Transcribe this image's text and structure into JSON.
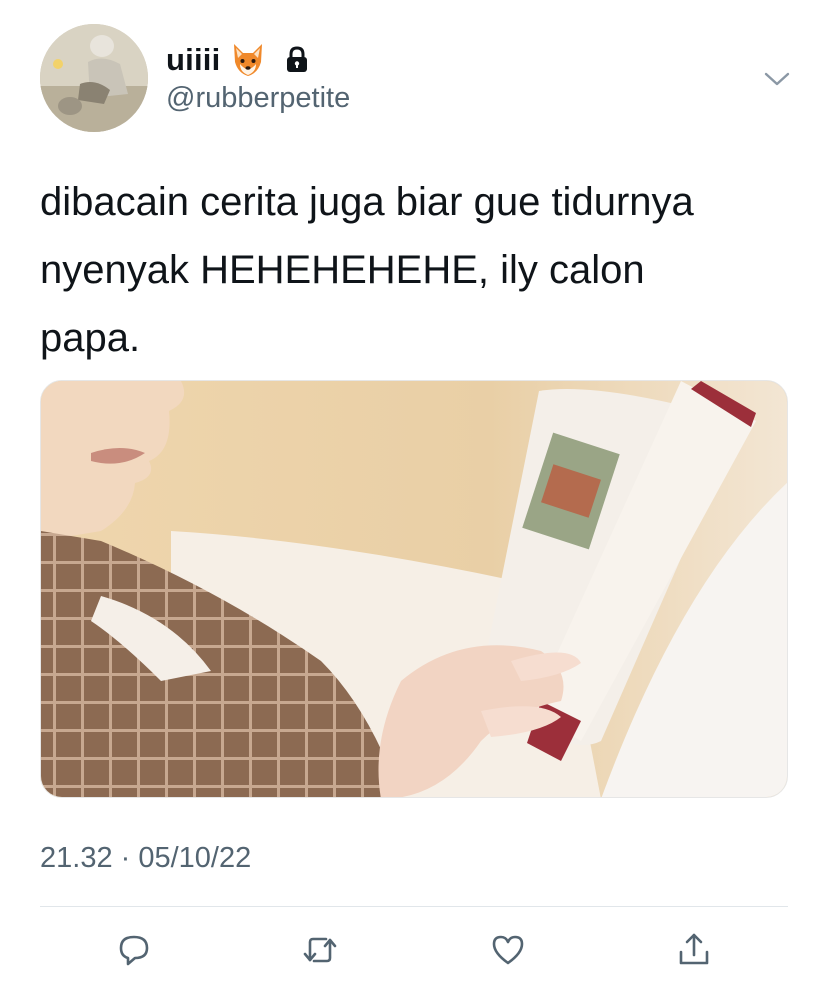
{
  "user": {
    "display_name": "uiiii",
    "name_emoji": "fox-emoji",
    "protected_icon": "lock-icon",
    "handle": "@rubberpetite"
  },
  "tweet": {
    "text": "dibacain cerita juga biar gue tidurnya\nnyenyak HEHEHEHEHE, ily calon\npapa.",
    "timestamp": "21.32 · 05/10/22"
  },
  "actions": [
    {
      "icon": "reply-icon"
    },
    {
      "icon": "retweet-icon"
    },
    {
      "icon": "like-icon"
    },
    {
      "icon": "share-icon"
    }
  ],
  "colors": {
    "text": "#0f1419",
    "secondary": "#536471",
    "divider": "#e1e6ea",
    "action_icon": "#536471"
  }
}
